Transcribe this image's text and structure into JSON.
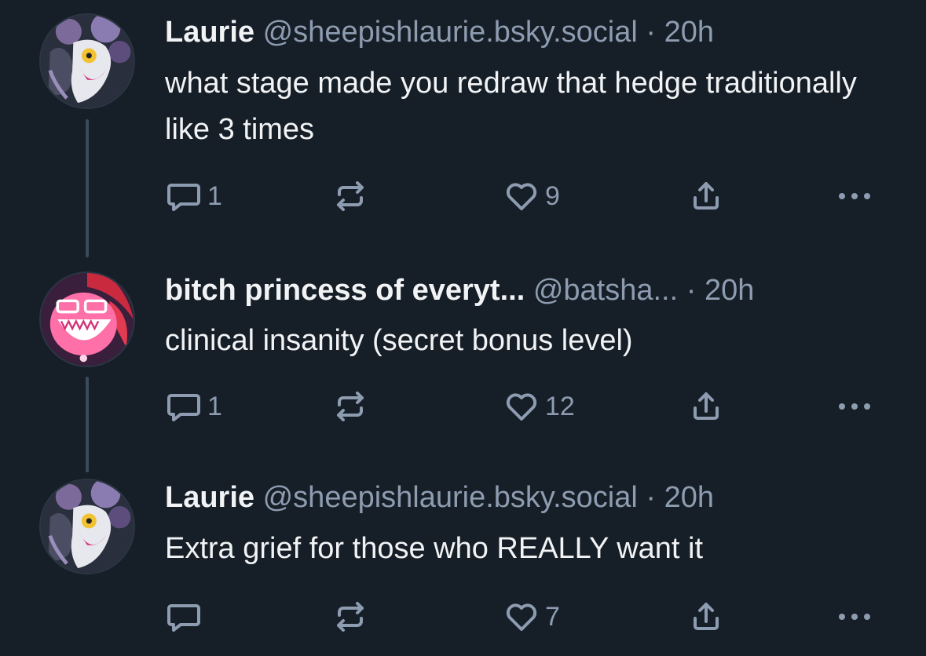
{
  "posts": [
    {
      "author_name": "Laurie",
      "handle": "@sheepishlaurie.bsky.social",
      "separator": "·",
      "time": "20h",
      "text": "what stage made you redraw that hedge traditionally like 3 times",
      "reply_count": "1",
      "like_count": "9",
      "avatar_icon": "avatar-laurie"
    },
    {
      "author_name": "bitch princess of everyt...",
      "handle": "@batsha...",
      "separator": "·",
      "time": "20h",
      "text": "clinical insanity (secret bonus level)",
      "reply_count": "1",
      "like_count": "12",
      "avatar_icon": "avatar-pink-character"
    },
    {
      "author_name": "Laurie",
      "handle": "@sheepishlaurie.bsky.social",
      "separator": "·",
      "time": "20h",
      "text": "Extra grief for those who REALLY want it",
      "reply_count": "",
      "like_count": "7",
      "avatar_icon": "avatar-laurie"
    }
  ],
  "icons": {
    "reply": "reply-bubble-icon",
    "repost": "repost-arrows-icon",
    "like": "heart-icon",
    "share": "share-upload-icon",
    "more": "more-dots-icon"
  },
  "colors": {
    "background": "#161e27",
    "text_primary": "#f1f3f5",
    "text_muted": "#8d9cb0",
    "thread_line": "#3c4a59"
  }
}
